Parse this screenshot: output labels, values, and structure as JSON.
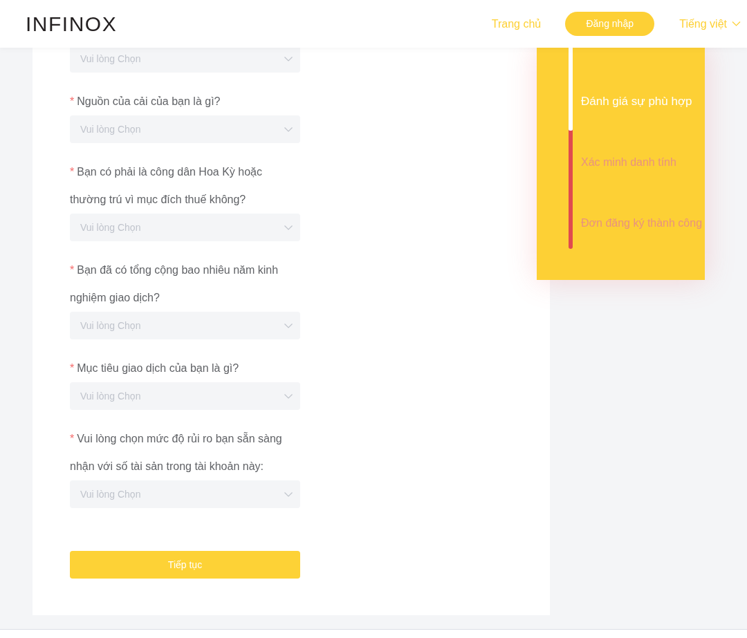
{
  "header": {
    "logo": "INFINOX",
    "nav_links": [
      {
        "label": "Trang chủ"
      }
    ],
    "login_button": "Đăng nhập",
    "language": "Tiếng việt"
  },
  "form": {
    "questions": [
      {
        "placeholder": "Vui lòng Chọn"
      },
      {
        "required_mark": "*",
        "label": "Nguồn của cải của bạn là gì?",
        "placeholder": "Vui lòng Chọn"
      },
      {
        "required_mark": "*",
        "label": "Bạn có phải là công dân Hoa Kỳ hoặc thường trú vì mục đích thuế không?",
        "placeholder": "Vui lòng Chọn"
      },
      {
        "required_mark": "*",
        "label": "Bạn đã có tổng cộng bao nhiêu năm kinh nghiệm giao dịch?",
        "placeholder": "Vui lòng Chọn"
      },
      {
        "required_mark": "*",
        "label": "Mục tiêu giao dịch của bạn là gì?",
        "placeholder": "Vui lòng Chọn"
      },
      {
        "required_mark": "*",
        "label": "Vui lòng chọn mức độ rủi ro bạn sẵn sàng nhận với số tài sản trong tài khoản này:",
        "placeholder": "Vui lòng Chọn"
      }
    ],
    "submit_button": "Tiếp tục"
  },
  "steps": {
    "progress": {
      "level": 0.42
    },
    "items": [
      {
        "label": "Đánh giá sự phù hợp",
        "selected": true
      },
      {
        "label": "Xác minh danh tính",
        "selected": false
      },
      {
        "label": "Đơn đăng ký thành công",
        "selected": false
      }
    ]
  }
}
